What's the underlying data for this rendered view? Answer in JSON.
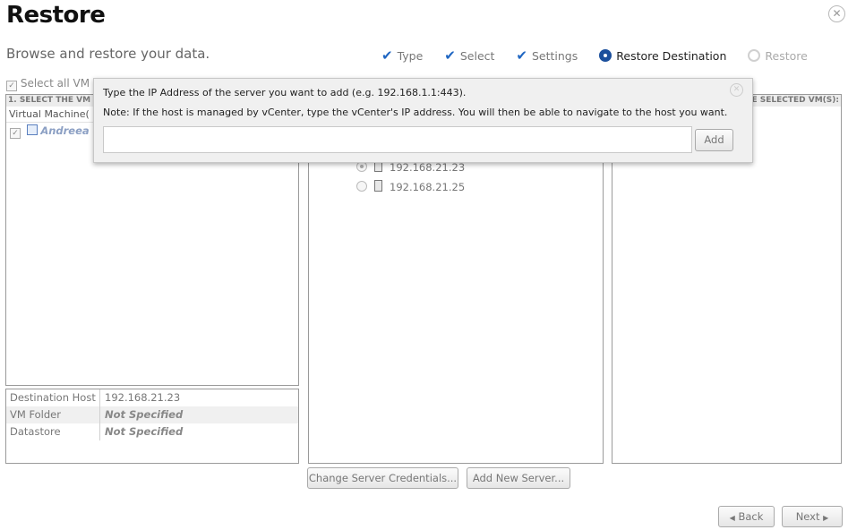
{
  "page": {
    "title": "Restore",
    "subtitle": "Browse and restore your data."
  },
  "steps": [
    {
      "label": "Type",
      "state": "done",
      "icon": "checkmark-icon"
    },
    {
      "label": "Select",
      "state": "done",
      "icon": "checkmark-icon"
    },
    {
      "label": "Settings",
      "state": "done",
      "icon": "checkmark-icon"
    },
    {
      "label": "Restore Destination",
      "state": "active",
      "icon": "active-step-icon"
    },
    {
      "label": "Restore",
      "state": "disabled",
      "icon": "inactive-step-icon"
    }
  ],
  "left": {
    "select_all": "Select all VM",
    "header": "1. SELECT THE VM",
    "column": "Virtual Machine(",
    "vm_name": "Andreea -"
  },
  "right": {
    "header": "E SELECTED VM(S):"
  },
  "servers": [
    {
      "ip": "192.168.21.23",
      "selected": true
    },
    {
      "ip": "192.168.21.25",
      "selected": false
    }
  ],
  "destination": [
    {
      "key": "Destination Host",
      "value": "192.168.21.23",
      "emphasis": false
    },
    {
      "key": "VM Folder",
      "value": "Not Specified",
      "emphasis": true
    },
    {
      "key": "Datastore",
      "value": "Not Specified",
      "emphasis": true
    }
  ],
  "buttons": {
    "change_credentials": "Change Server Credentials...",
    "add_server": "Add New Server...",
    "back": "Back",
    "next": "Next"
  },
  "popup": {
    "line1": "Type the IP Address of the server you want to add (e.g. 192.168.1.1:443).",
    "line2": "Note: If the host is managed by vCenter, type the vCenter's IP address. You will then be able to navigate to the host you want.",
    "input_value": "",
    "add_label": "Add"
  },
  "colors": {
    "accent": "#1f66c2",
    "active_step": "#1b4f9c"
  }
}
